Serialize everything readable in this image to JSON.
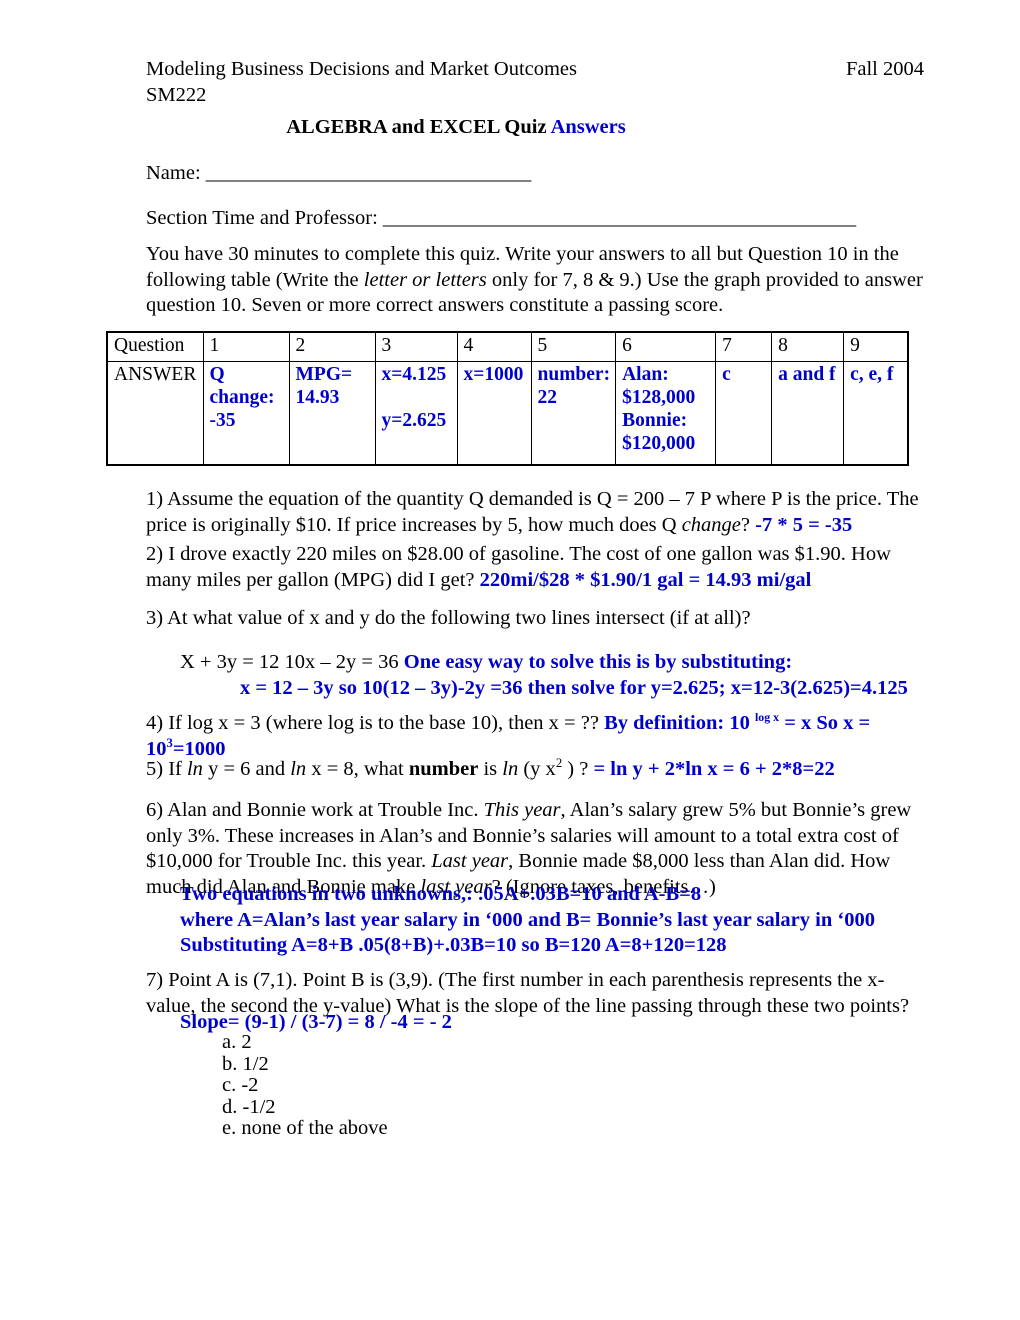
{
  "header": {
    "course_title": "Modeling Business Decisions and Market Outcomes",
    "term": "Fall 2004",
    "course_code": "SM222",
    "quiz_title_main": "ALGEBRA and EXCEL Quiz ",
    "quiz_title_accent": "Answers"
  },
  "fields": {
    "name_label": "Name: ",
    "name_blank": "_________________________________",
    "section_label": "Section Time and Professor:  ",
    "section_blank": "________________________________________________"
  },
  "instructions": {
    "part1": "You have 30 minutes to complete this quiz. Write your answers to all but Question 10 in the following table (Write the ",
    "italic": "letter or letters",
    "part2": "  only for 7, 8 & 9.)  Use the graph provided to answer question 10. Seven or more correct answers constitute a passing score."
  },
  "answer_table": {
    "row_header_label": "Question",
    "row_answer_label": "ANSWER",
    "columns": [
      "1",
      "2",
      "3",
      "4",
      "5",
      "6",
      "7",
      "8",
      "9"
    ],
    "answers": [
      {
        "line1": "Q",
        "line2": "change:",
        "line3": "-35",
        "gap_before_last": false
      },
      {
        "line1": "MPG=",
        "line2": "14.93",
        "line3": "",
        "gap_before_last": false
      },
      {
        "line1": "x=4.125",
        "line2": "",
        "line3": "y=2.625",
        "gap_before_last": true
      },
      {
        "line1": "x=1000",
        "line2": "",
        "line3": "",
        "gap_before_last": false
      },
      {
        "line1": "number:",
        "line2": "22",
        "line3": "",
        "gap_before_last": false
      },
      {
        "line1": "Alan:",
        "line2": "$128,000",
        "line3": "Bonnie:",
        "line4": "$120,000",
        "gap_before_last": false
      },
      {
        "line1": "c",
        "line2": "",
        "line3": "",
        "gap_before_last": false
      },
      {
        "line1": "a and f",
        "line2": "",
        "line3": "",
        "gap_before_last": false
      },
      {
        "line1": "c, e, f",
        "line2": "",
        "line3": "",
        "gap_before_last": false
      }
    ]
  },
  "questions": {
    "q1": {
      "text_a": "1)   Assume the equation of the quantity Q demanded is   Q = 200 – 7 P    where P is the price. The price is originally $10.  If price increases by 5, how much does Q ",
      "italic": "change",
      "text_b": "? ",
      "answer": "-7 * 5 = -35"
    },
    "q2": {
      "text": "2)  I drove exactly 220 miles on  $28.00 of gasoline.  The cost of one gallon was $1.90.  How many miles per gallon (MPG) did I get?   ",
      "answer": "220mi/$28   *  $1.90/1 gal  = 14.93  mi/gal"
    },
    "q3": {
      "text": "3)  At what value of x and y do the following two lines intersect (if at all)?",
      "equations": "X + 3y = 12    10x – 2y = 36    ",
      "answer_line1": "One easy way to solve this is by substituting:",
      "answer_line2": "x = 12 – 3y   so  10(12 – 3y)-2y =36  then solve for y=2.625; x=12-3(2.625)=4.125"
    },
    "q4": {
      "text": "4)  If log x = 3 (where log is to the base 10), then x = ?? ",
      "answer_a": "By definition: 10 ",
      "answer_sup": "log x",
      "answer_b": " = x   So  x = 10",
      "answer_sup2": "3",
      "answer_c": "=1000"
    },
    "q5": {
      "text_a": "5)   If ",
      "ln1": "ln",
      "text_b": " y = 6 and ",
      "ln2": "ln",
      "text_c": " x =  8,  what ",
      "bold_word": "number",
      "text_d": " is  ",
      "ln3": "ln",
      "text_e": "  (y x",
      "sup": "2",
      "text_f": " ) ? ",
      "answer": "= ln y + 2*ln x = 6 + 2*8=22"
    },
    "q6": {
      "text_a": "6)  Alan and Bonnie work at Trouble Inc.  ",
      "italic1": "This year",
      "text_b": ", Alan’s salary grew 5% but Bonnie’s grew only 3%.  These increases in Alan’s and Bonnie’s salaries will amount to a total extra cost of $10,000 for Trouble Inc. this year.  ",
      "italic2": "Last year",
      "text_c": ", Bonnie made $8,000 less than Alan did.  How much did Alan and Bonnie make ",
      "italic3": "last year",
      "text_d": "?  (Ignore taxes, benefits…)",
      "answer_line1": "Two equations in two unknowns,:  .05A+.03B=10   and     A-B=8",
      "answer_line2": "where A=Alan’s last year salary in ‘000 and B= Bonnie’s last year salary in ‘000",
      "answer_line3": "Substituting A=8+B   .05(8+B)+.03B=10  so   B=120   A=8+120=128"
    },
    "q7": {
      "text": "7)  Point A is (7,1).  Point B is (3,9).  (The first number in each parenthesis represents the x-value, the second the y-value)     What is the slope of the line passing through these two points?",
      "answer": "Slope= (9-1) / (3-7) = 8 / -4 = - 2",
      "choices": [
        "a.  2",
        "b. 1/2",
        "c.  -2",
        "d.  -1/2",
        "e. none of the above"
      ]
    }
  },
  "colors": {
    "answer_blue": "#0000CC",
    "body_text": "#000000",
    "page_background": "#ffffff"
  }
}
